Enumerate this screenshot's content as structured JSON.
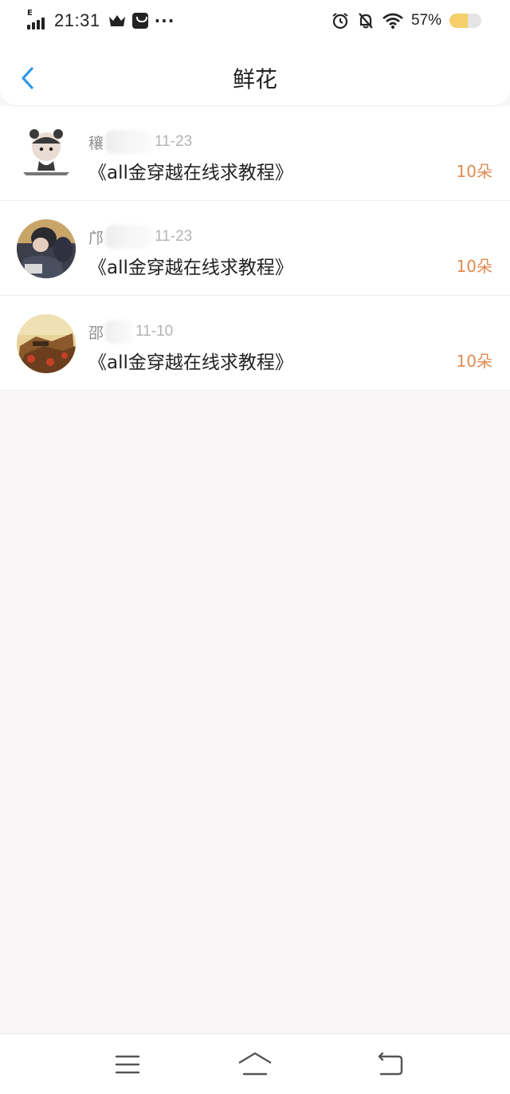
{
  "status_bar": {
    "network": "E",
    "time": "21:31",
    "battery_percent": "57%",
    "battery_level": 0.57,
    "icons": [
      "signal-icon",
      "crown-icon",
      "shopping-bag-icon",
      "more-dots-icon",
      "alarm-icon",
      "mute-bell-icon",
      "wifi-icon",
      "battery-icon"
    ]
  },
  "header": {
    "title": "鲜花",
    "back_icon": "chevron-left-icon"
  },
  "colors": {
    "accent_blue": "#2f9be8",
    "count_orange": "#e08a4e",
    "meta_gray": "#9a9a9a"
  },
  "records": [
    {
      "name": "穰",
      "date": "11-23",
      "book": "《all金穿越在线求教程》",
      "count": "10朵"
    },
    {
      "name": "邝",
      "date": "11-23",
      "book": "《all金穿越在线求教程》",
      "count": "10朵"
    },
    {
      "name": "邵",
      "date": "11-10",
      "book": "《all金穿越在线求教程》",
      "count": "10朵"
    }
  ],
  "nav_bar": {
    "icons": [
      "menu-icon",
      "home-icon",
      "back-return-icon"
    ]
  }
}
